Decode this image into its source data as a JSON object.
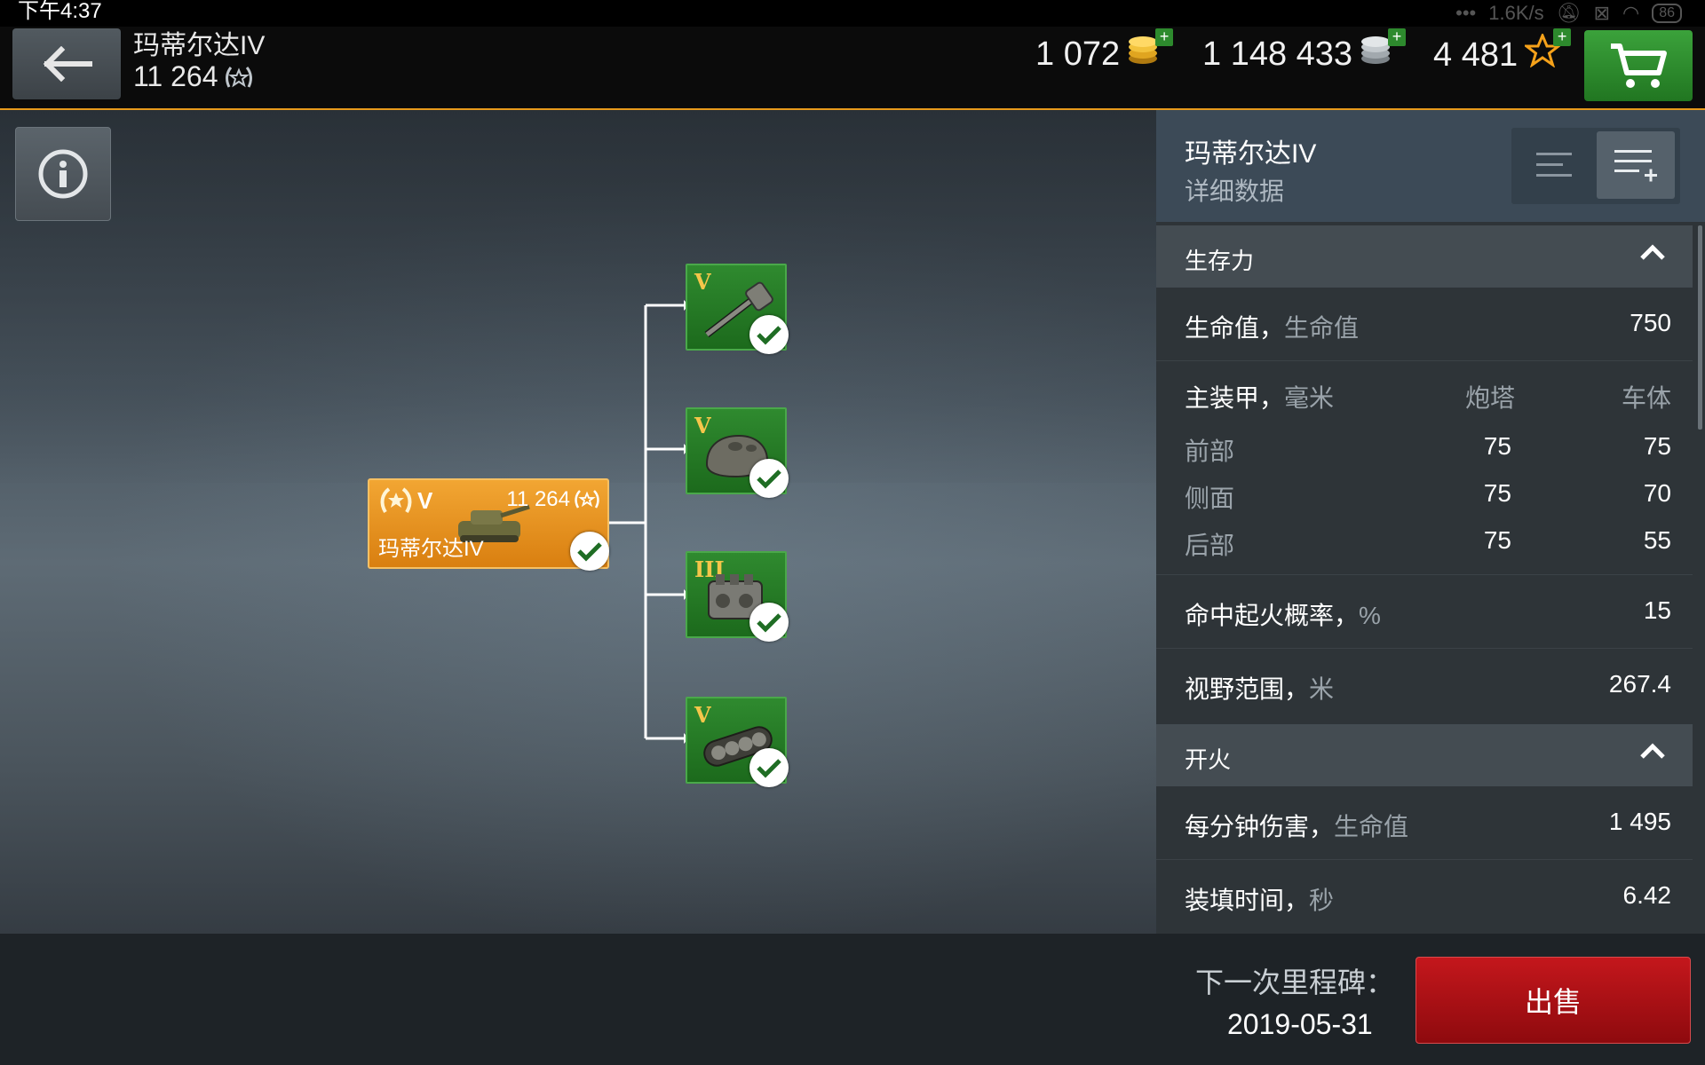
{
  "status_bar": {
    "time": "下午4:37",
    "net_speed": "1.6K/s",
    "battery": "86"
  },
  "header": {
    "tank_name": "玛蒂尔达IV",
    "tank_xp": "11 264",
    "gold": "1 072",
    "silver": "1 148 433",
    "free_xp": "4 481"
  },
  "tree": {
    "tank": {
      "tier": "V",
      "name": "玛蒂尔达IV",
      "xp": "11 264",
      "color": "#e8901c"
    },
    "modules": [
      {
        "tier": "V",
        "icon": "gun-module-icon"
      },
      {
        "tier": "V",
        "icon": "turret-module-icon"
      },
      {
        "tier": "III",
        "icon": "engine-module-icon"
      },
      {
        "tier": "V",
        "icon": "tracks-module-icon"
      }
    ]
  },
  "panel": {
    "title": "玛蒂尔达IV",
    "subtitle": "详细数据",
    "sections": {
      "survivability": {
        "title": "生存力",
        "hp_label": "生命值，",
        "hp_unit": "生命值",
        "hp_value": "750",
        "armor_label": "主装甲，",
        "armor_unit": "毫米",
        "armor_col_turret": "炮塔",
        "armor_col_hull": "车体",
        "armor_rows": [
          {
            "name": "前部",
            "turret": "75",
            "hull": "75"
          },
          {
            "name": "侧面",
            "turret": "75",
            "hull": "70"
          },
          {
            "name": "后部",
            "turret": "75",
            "hull": "55"
          }
        ],
        "fire_label": "命中起火概率，",
        "fire_unit": "%",
        "fire_value": "15",
        "view_label": "视野范围，",
        "view_unit": "米",
        "view_value": "267.4"
      },
      "firepower": {
        "title": "开火",
        "dpm_label": "每分钟伤害，",
        "dpm_unit": "生命值",
        "dpm_value": "1 495",
        "reload_label": "装填时间，",
        "reload_unit": "秒",
        "reload_value": "6.42"
      }
    }
  },
  "footer": {
    "milestone_label": "下一次里程碑：",
    "milestone_date": "2019-05-31",
    "sell_label": "出售"
  },
  "colors": {
    "accent_orange": "#e79a1c",
    "module_green": "#2f8a2f",
    "sell_red": "#b01217",
    "cart_green": "#2e8f2e"
  }
}
